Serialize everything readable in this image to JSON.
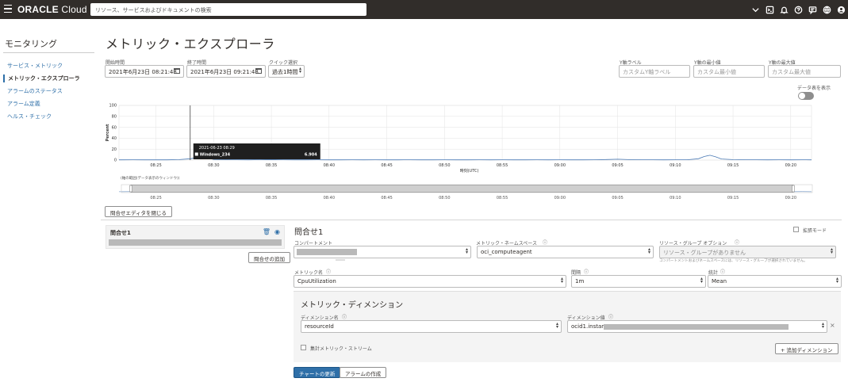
{
  "header": {
    "logo_bold": "ORACLE",
    "logo_rest": " Cloud",
    "search_placeholder": "リソース、サービスおよびドキュメントの検索",
    "icons": [
      "region-chevron-icon",
      "cloud-shell-icon",
      "notification-bell-icon",
      "help-icon",
      "chat-icon",
      "language-globe-icon",
      "user-profile-icon"
    ]
  },
  "sidebar": {
    "title": "モニタリング",
    "items": [
      {
        "label": "サービス・メトリック",
        "active": false
      },
      {
        "label": "メトリック・エクスプローラ",
        "active": true
      },
      {
        "label": "アラームのステータス",
        "active": false
      },
      {
        "label": "アラーム定義",
        "active": false
      },
      {
        "label": "ヘルス・チェック",
        "active": false
      }
    ]
  },
  "page": {
    "title": "メトリック・エクスプローラ",
    "start_label": "開始時間",
    "start_value": "2021年6月23日 08:21:48",
    "end_label": "終了時間",
    "end_value": "2021年6月23日 09:21:48",
    "quick_label": "クイック選択",
    "quick_value": "過去1時間",
    "y_label_label": "Y軸ラベル",
    "y_label_placeholder": "カスタムY軸ラベル",
    "y_min_label": "Y軸の最小値",
    "y_min_placeholder": "カスタム最小値",
    "y_max_label": "Y軸の最大値",
    "y_max_placeholder": "カスタム最大値",
    "data_table_toggle_label": "データ表を表示",
    "close_editor_button": "問合せエディタを閉じる"
  },
  "chart_data": {
    "type": "line",
    "ylabel": "Percent",
    "xlabel": "時刻(UTC)",
    "ylim": [
      0,
      100
    ],
    "yticks": [
      0,
      20,
      40,
      60,
      80,
      100
    ],
    "xticks": [
      "08:25",
      "08:30",
      "08:35",
      "08:40",
      "08:45",
      "08:50",
      "08:55",
      "09:00",
      "09:05",
      "09:10",
      "09:15",
      "09:20"
    ],
    "series": [
      {
        "name": "Windows_234",
        "color": "#4a7ab5",
        "x_minutes": [
          21.8,
          22,
          23,
          24,
          25,
          26,
          27,
          28,
          28.5,
          29,
          30,
          31,
          32,
          33,
          34,
          35,
          36,
          37,
          38,
          39,
          40,
          41,
          42,
          43,
          44,
          45,
          46,
          47,
          48,
          49,
          50,
          51,
          52,
          53,
          54,
          55,
          56,
          57,
          58,
          59,
          60,
          61,
          62,
          63,
          64,
          65,
          66,
          67,
          68,
          69,
          70,
          71,
          72,
          72.5,
          73,
          73.5,
          74,
          75,
          76,
          77,
          78,
          79,
          80,
          81,
          81.8
        ],
        "values": [
          0.5,
          0.4,
          0.6,
          0.5,
          0.5,
          0.4,
          0.8,
          2.5,
          4.5,
          6.9,
          1.2,
          0.8,
          0.6,
          0.5,
          0.7,
          1.0,
          0.6,
          0.5,
          0.5,
          0.6,
          0.5,
          0.5,
          0.6,
          0.5,
          0.6,
          0.5,
          0.5,
          0.6,
          0.5,
          0.5,
          0.6,
          0.5,
          0.5,
          0.6,
          0.5,
          0.6,
          0.5,
          0.5,
          0.6,
          0.5,
          0.6,
          0.5,
          0.5,
          0.6,
          1.0,
          1.6,
          0.8,
          0.6,
          0.6,
          0.5,
          0.6,
          0.6,
          2.5,
          6.5,
          8.8,
          6.0,
          2.0,
          0.8,
          0.6,
          0.6,
          0.5,
          0.6,
          0.5,
          0.6,
          0.5
        ]
      }
    ],
    "tooltip": {
      "time": "2021-06-23 08:29",
      "series": "Windows_234",
      "value": "6.904"
    },
    "navigator_label": "(軸の範囲(データ表示のウィンドウ))",
    "legend": "none"
  },
  "query": {
    "card_title": "問合せ1",
    "add_query_button": "問合せの追加",
    "heading": "問合せ1",
    "advanced_mode_label": "拡張モード",
    "compartment_label": "コンパートメント",
    "namespace_label": "メトリック・ネームスペース",
    "namespace_value": "oci_computeagent",
    "resource_group_label": "リソース・グループ オプション",
    "resource_group_value": "リソース・グループがありません",
    "resource_group_help": "コンパートメントおよびネームスペースには、リソース・グループが選択されていません。",
    "metric_name_label": "メトリック名",
    "metric_name_value": "CpuUtilization",
    "interval_label": "間隔",
    "interval_value": "1m",
    "statistic_label": "統計",
    "statistic_value": "Mean",
    "dimension_heading": "メトリック・ディメンション",
    "dimension_name_label": "ディメンション名",
    "dimension_name_value": "resourceId",
    "dimension_value_label": "ディメンション値",
    "dimension_value_value": "ocid1.instance",
    "aggregate_stream_label": "集計メトリック・ストリーム",
    "add_dimension_button": "+ 追加ディメンション",
    "update_chart_button": "チャートの更新",
    "create_alarm_button": "アラームの作成"
  }
}
